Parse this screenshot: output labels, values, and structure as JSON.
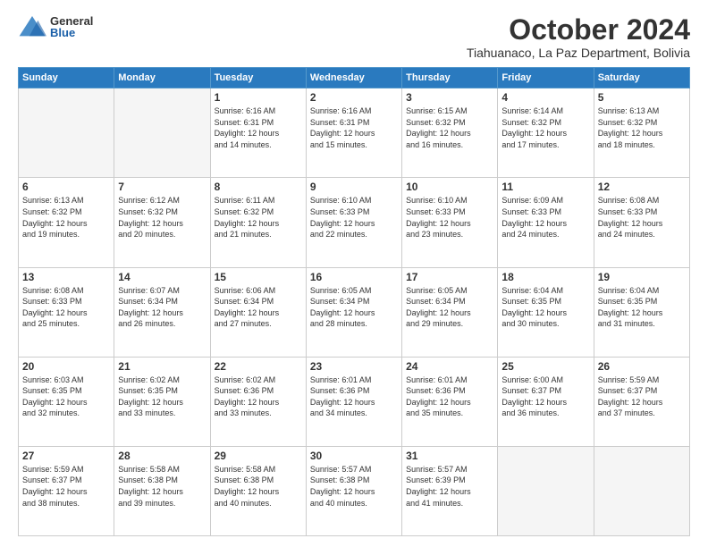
{
  "logo": {
    "general": "General",
    "blue": "Blue"
  },
  "header": {
    "month": "October 2024",
    "location": "Tiahuanaco, La Paz Department, Bolivia"
  },
  "days_of_week": [
    "Sunday",
    "Monday",
    "Tuesday",
    "Wednesday",
    "Thursday",
    "Friday",
    "Saturday"
  ],
  "weeks": [
    [
      {
        "day": "",
        "empty": true
      },
      {
        "day": "",
        "empty": true
      },
      {
        "day": "1",
        "sunrise": "6:16 AM",
        "sunset": "6:31 PM",
        "daylight": "12 hours and 14 minutes."
      },
      {
        "day": "2",
        "sunrise": "6:16 AM",
        "sunset": "6:31 PM",
        "daylight": "12 hours and 15 minutes."
      },
      {
        "day": "3",
        "sunrise": "6:15 AM",
        "sunset": "6:32 PM",
        "daylight": "12 hours and 16 minutes."
      },
      {
        "day": "4",
        "sunrise": "6:14 AM",
        "sunset": "6:32 PM",
        "daylight": "12 hours and 17 minutes."
      },
      {
        "day": "5",
        "sunrise": "6:13 AM",
        "sunset": "6:32 PM",
        "daylight": "12 hours and 18 minutes."
      }
    ],
    [
      {
        "day": "6",
        "sunrise": "6:13 AM",
        "sunset": "6:32 PM",
        "daylight": "12 hours and 19 minutes."
      },
      {
        "day": "7",
        "sunrise": "6:12 AM",
        "sunset": "6:32 PM",
        "daylight": "12 hours and 20 minutes."
      },
      {
        "day": "8",
        "sunrise": "6:11 AM",
        "sunset": "6:32 PM",
        "daylight": "12 hours and 21 minutes."
      },
      {
        "day": "9",
        "sunrise": "6:10 AM",
        "sunset": "6:33 PM",
        "daylight": "12 hours and 22 minutes."
      },
      {
        "day": "10",
        "sunrise": "6:10 AM",
        "sunset": "6:33 PM",
        "daylight": "12 hours and 23 minutes."
      },
      {
        "day": "11",
        "sunrise": "6:09 AM",
        "sunset": "6:33 PM",
        "daylight": "12 hours and 24 minutes."
      },
      {
        "day": "12",
        "sunrise": "6:08 AM",
        "sunset": "6:33 PM",
        "daylight": "12 hours and 24 minutes."
      }
    ],
    [
      {
        "day": "13",
        "sunrise": "6:08 AM",
        "sunset": "6:33 PM",
        "daylight": "12 hours and 25 minutes."
      },
      {
        "day": "14",
        "sunrise": "6:07 AM",
        "sunset": "6:34 PM",
        "daylight": "12 hours and 26 minutes."
      },
      {
        "day": "15",
        "sunrise": "6:06 AM",
        "sunset": "6:34 PM",
        "daylight": "12 hours and 27 minutes."
      },
      {
        "day": "16",
        "sunrise": "6:05 AM",
        "sunset": "6:34 PM",
        "daylight": "12 hours and 28 minutes."
      },
      {
        "day": "17",
        "sunrise": "6:05 AM",
        "sunset": "6:34 PM",
        "daylight": "12 hours and 29 minutes."
      },
      {
        "day": "18",
        "sunrise": "6:04 AM",
        "sunset": "6:35 PM",
        "daylight": "12 hours and 30 minutes."
      },
      {
        "day": "19",
        "sunrise": "6:04 AM",
        "sunset": "6:35 PM",
        "daylight": "12 hours and 31 minutes."
      }
    ],
    [
      {
        "day": "20",
        "sunrise": "6:03 AM",
        "sunset": "6:35 PM",
        "daylight": "12 hours and 32 minutes."
      },
      {
        "day": "21",
        "sunrise": "6:02 AM",
        "sunset": "6:35 PM",
        "daylight": "12 hours and 33 minutes."
      },
      {
        "day": "22",
        "sunrise": "6:02 AM",
        "sunset": "6:36 PM",
        "daylight": "12 hours and 33 minutes."
      },
      {
        "day": "23",
        "sunrise": "6:01 AM",
        "sunset": "6:36 PM",
        "daylight": "12 hours and 34 minutes."
      },
      {
        "day": "24",
        "sunrise": "6:01 AM",
        "sunset": "6:36 PM",
        "daylight": "12 hours and 35 minutes."
      },
      {
        "day": "25",
        "sunrise": "6:00 AM",
        "sunset": "6:37 PM",
        "daylight": "12 hours and 36 minutes."
      },
      {
        "day": "26",
        "sunrise": "5:59 AM",
        "sunset": "6:37 PM",
        "daylight": "12 hours and 37 minutes."
      }
    ],
    [
      {
        "day": "27",
        "sunrise": "5:59 AM",
        "sunset": "6:37 PM",
        "daylight": "12 hours and 38 minutes."
      },
      {
        "day": "28",
        "sunrise": "5:58 AM",
        "sunset": "6:38 PM",
        "daylight": "12 hours and 39 minutes."
      },
      {
        "day": "29",
        "sunrise": "5:58 AM",
        "sunset": "6:38 PM",
        "daylight": "12 hours and 40 minutes."
      },
      {
        "day": "30",
        "sunrise": "5:57 AM",
        "sunset": "6:38 PM",
        "daylight": "12 hours and 40 minutes."
      },
      {
        "day": "31",
        "sunrise": "5:57 AM",
        "sunset": "6:39 PM",
        "daylight": "12 hours and 41 minutes."
      },
      {
        "day": "",
        "empty": true
      },
      {
        "day": "",
        "empty": true
      }
    ]
  ],
  "labels": {
    "sunrise": "Sunrise:",
    "sunset": "Sunset:",
    "daylight": "Daylight:"
  }
}
